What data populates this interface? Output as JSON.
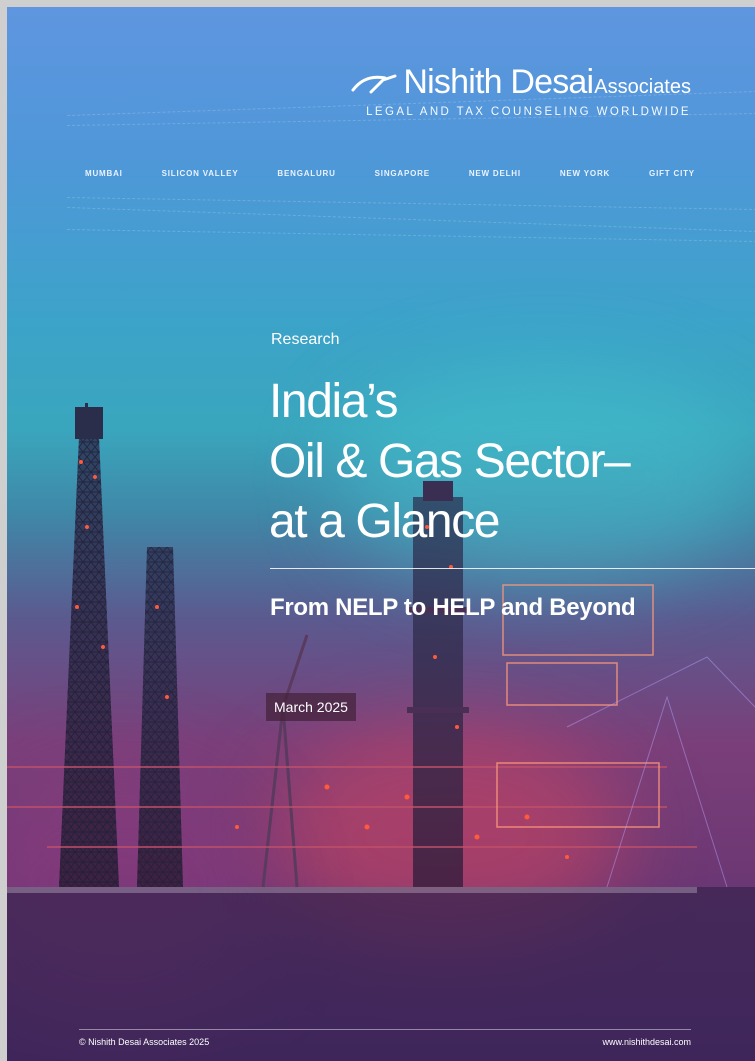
{
  "header": {
    "firm_name": "Nishith Desai",
    "firm_suffix": "Associates",
    "tagline": "LEGAL AND TAX COUNSELING WORLDWIDE"
  },
  "offices": [
    "MUMBAI",
    "SILICON VALLEY",
    "BENGALURU",
    "SINGAPORE",
    "NEW DELHI",
    "NEW YORK",
    "GIFT CITY"
  ],
  "cover": {
    "category": "Research",
    "title_lines": [
      "India’s",
      "Oil & Gas Sector–",
      "at a Glance"
    ],
    "subtitle": "From NELP to HELP and Beyond",
    "date": "March 2025"
  },
  "footer": {
    "copyright": "© Nishith Desai Associates 2025",
    "website": "www.nishithdesai.com"
  },
  "colors": {
    "sky_top": "#5f96df",
    "teal_mid": "#3aa6bd",
    "magenta_low": "#7a3f7a",
    "purple_bottom": "#4a2a7a",
    "refinery_lights": "#ff5a3c"
  },
  "icons": [
    "logo-mark-icon"
  ]
}
